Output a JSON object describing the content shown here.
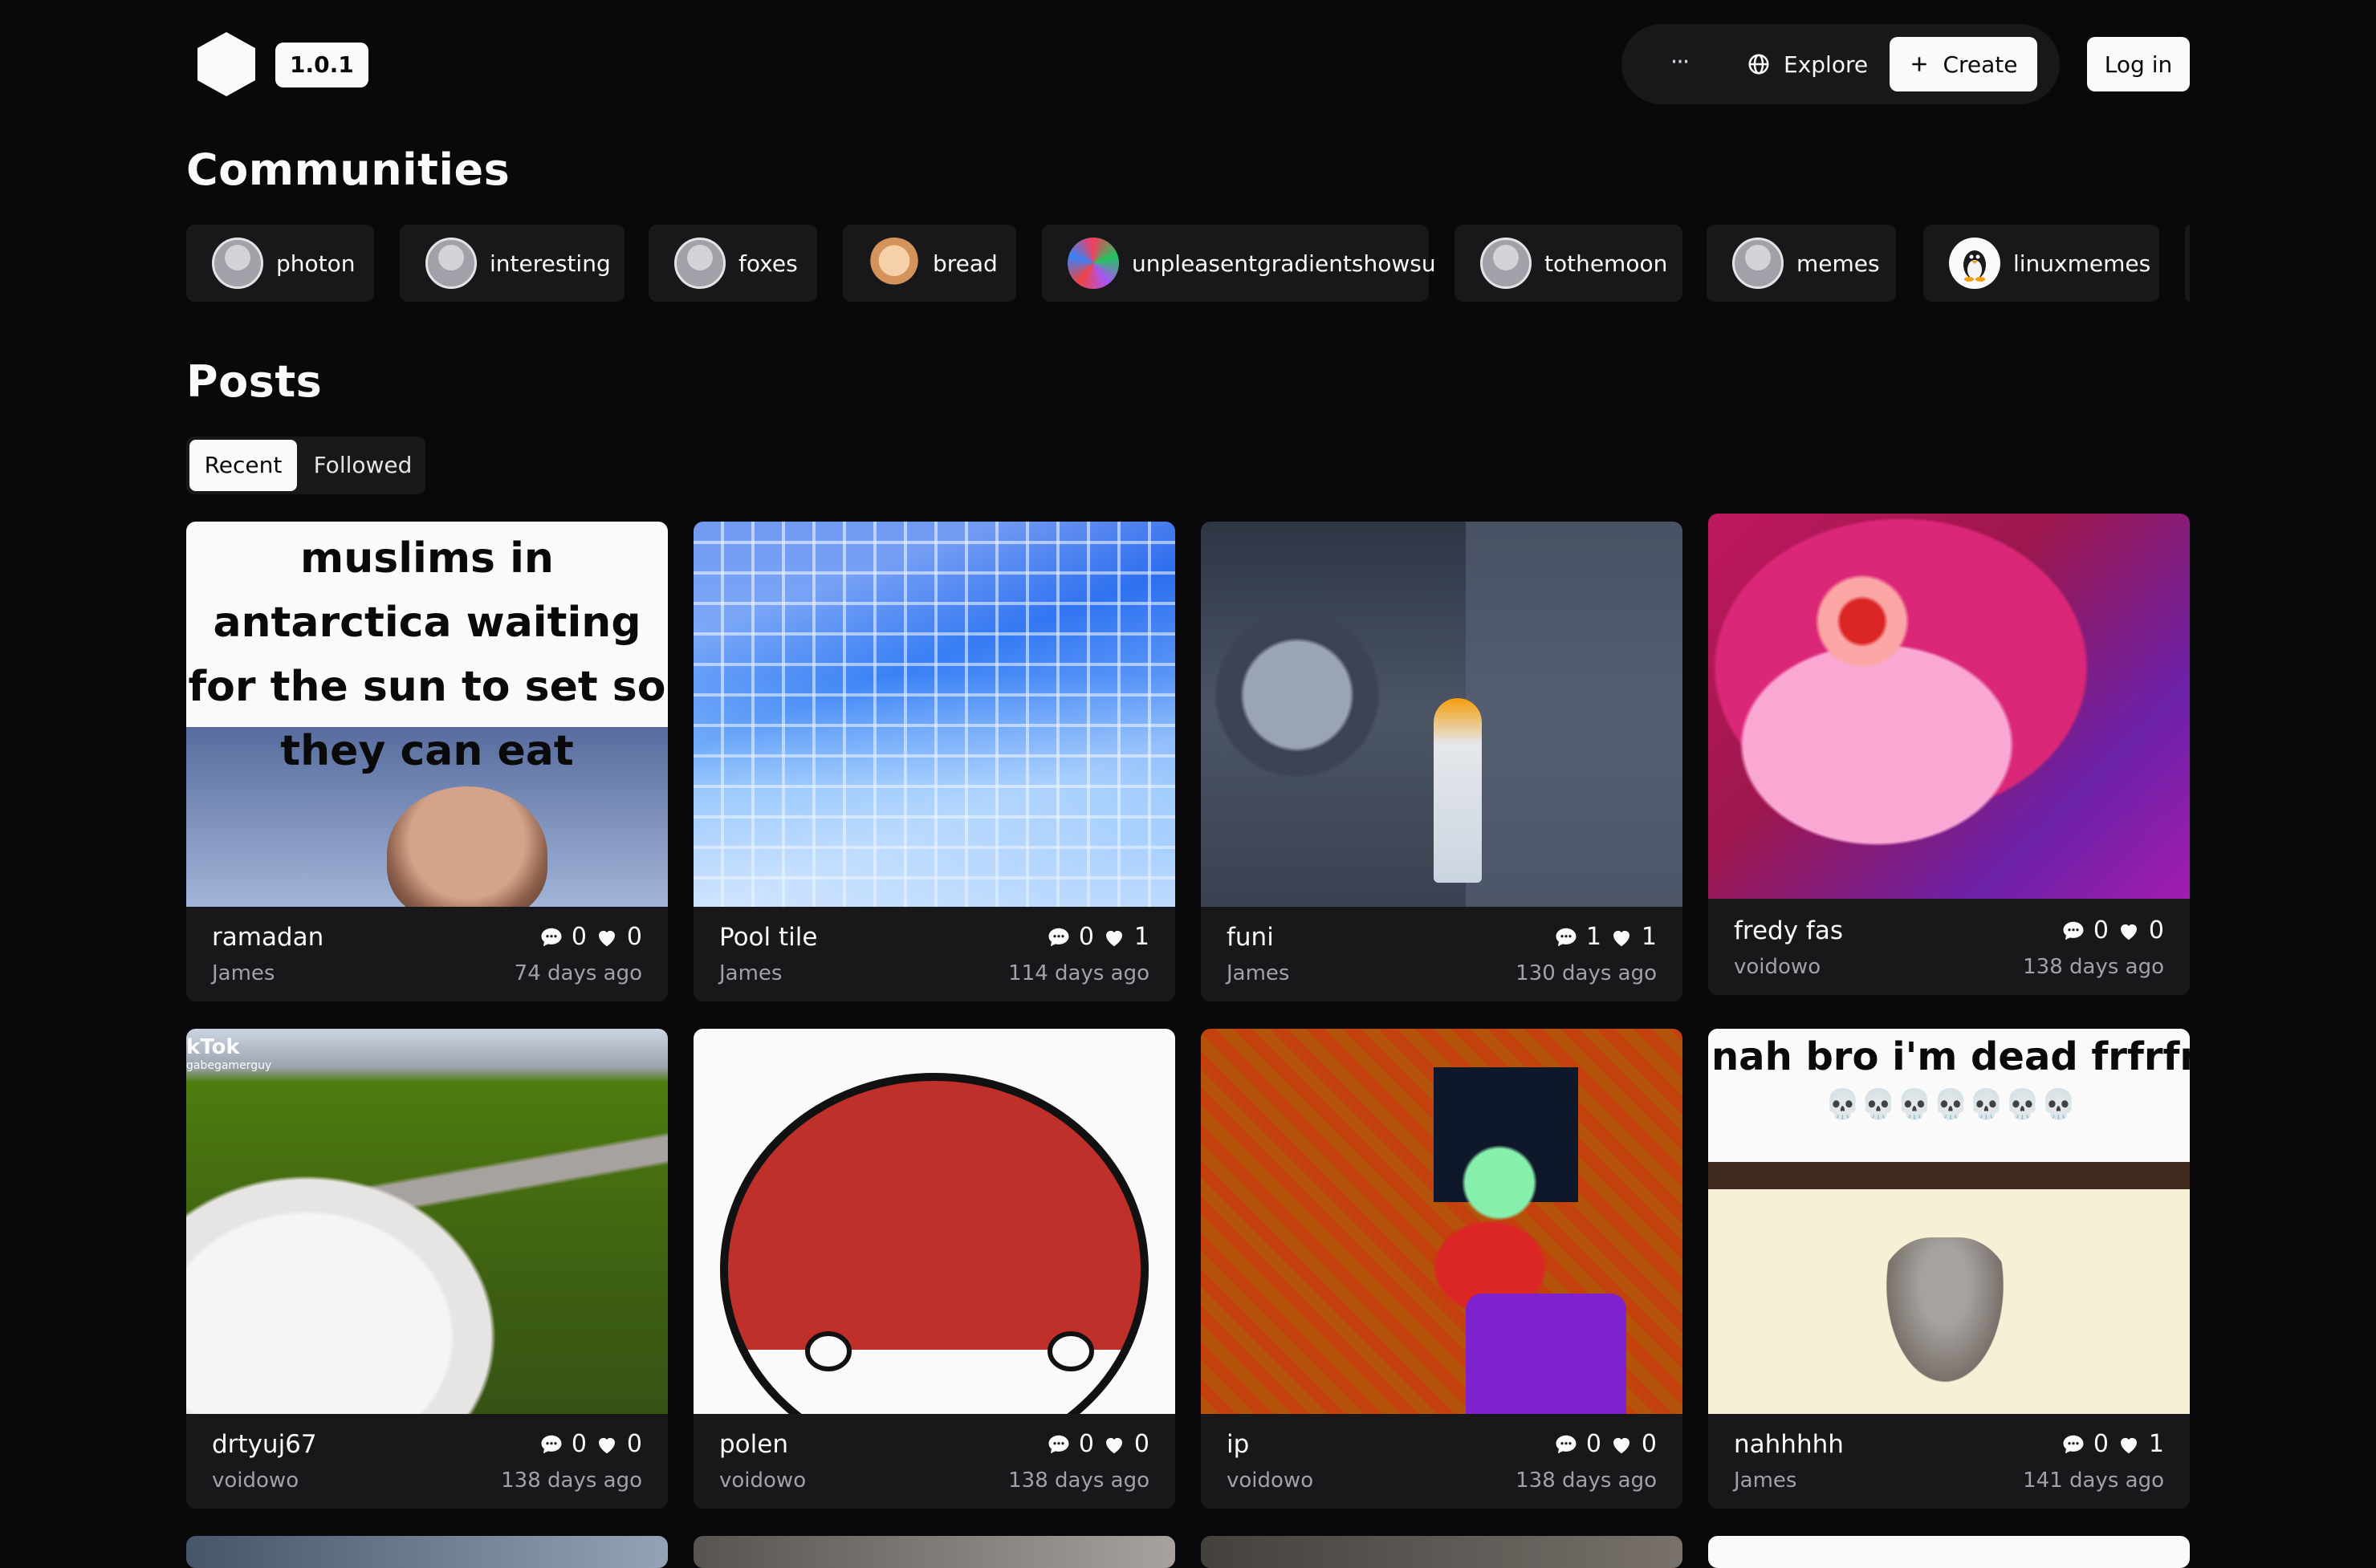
{
  "header": {
    "version": "1.0.1",
    "more_label": "···",
    "explore_label": "Explore",
    "create_label": "Create",
    "login_label": "Log in"
  },
  "communities": {
    "heading": "Communities",
    "items": [
      {
        "name": "photon",
        "avatar": "default-avatar"
      },
      {
        "name": "interesting",
        "avatar": "default-avatar"
      },
      {
        "name": "foxes",
        "avatar": "default-avatar"
      },
      {
        "name": "bread",
        "avatar": "bread-avatar"
      },
      {
        "name": "unpleasentgradientshowsu",
        "avatar": "gradient-avatar"
      },
      {
        "name": "tothemoon",
        "avatar": "default-avatar"
      },
      {
        "name": "memes",
        "avatar": "default-avatar"
      },
      {
        "name": "linuxmemes",
        "avatar": "tux-avatar"
      }
    ]
  },
  "posts": {
    "heading": "Posts",
    "tabs": {
      "recent": "Recent",
      "followed": "Followed",
      "selected": "Recent"
    },
    "items": [
      {
        "title": "ramadan",
        "author": "James",
        "comments": "0",
        "likes": "0",
        "age": "74 days ago",
        "caption": "muslims in antarctica waiting for the sun to set so they can eat"
      },
      {
        "title": "Pool tile",
        "author": "James",
        "comments": "0",
        "likes": "1",
        "age": "114 days ago"
      },
      {
        "title": "funi",
        "author": "James",
        "comments": "1",
        "likes": "1",
        "age": "130 days ago"
      },
      {
        "title": "fredy fas",
        "author": "voidowo",
        "comments": "0",
        "likes": "0",
        "age": "138 days ago"
      },
      {
        "title": "drtyuj67",
        "author": "voidowo",
        "comments": "0",
        "likes": "0",
        "age": "138 days ago",
        "overlay": "kTok",
        "overlay_sub": "gabegamerguy"
      },
      {
        "title": "polen",
        "author": "voidowo",
        "comments": "0",
        "likes": "0",
        "age": "138 days ago"
      },
      {
        "title": "ip",
        "author": "voidowo",
        "comments": "0",
        "likes": "0",
        "age": "138 days ago"
      },
      {
        "title": "nahhhhh",
        "author": "James",
        "comments": "0",
        "likes": "1",
        "age": "141 days ago",
        "caption": "nah bro i'm dead frfrfr",
        "emoji": "💀💀💀💀💀💀💀"
      }
    ]
  }
}
